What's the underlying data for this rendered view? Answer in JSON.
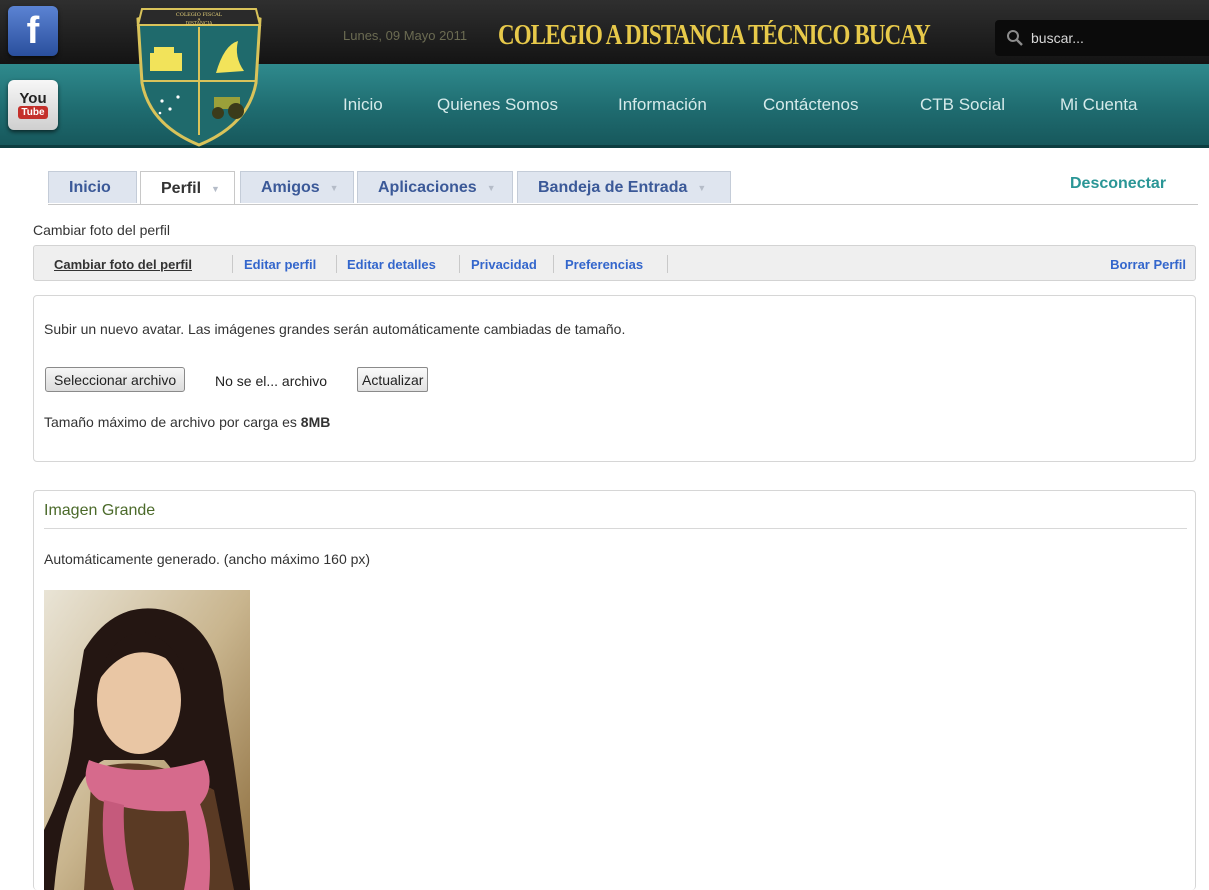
{
  "header": {
    "date": "Lunes, 09 Mayo 2011",
    "title": "COLEGIO A DISTANCIA TÉCNICO BUCAY",
    "search_placeholder": "buscar...",
    "social": {
      "facebook_letter": "f",
      "youtube_top": "You",
      "youtube_bottom": "Tube"
    },
    "logo": {
      "line1": "COLEGIO FISCAL",
      "line2": "A",
      "line3": "DISTANCIA"
    },
    "nav": [
      "Inicio",
      "Quienes Somos",
      "Información",
      "Contáctenos",
      "CTB Social",
      "Mi Cuenta"
    ]
  },
  "tabs": {
    "items": [
      {
        "label": "Inicio"
      },
      {
        "label": "Perfil"
      },
      {
        "label": "Amigos"
      },
      {
        "label": "Aplicaciones"
      },
      {
        "label": "Bandeja de Entrada"
      }
    ],
    "arrow": "▼",
    "active": "Perfil",
    "logout": "Desconectar"
  },
  "breadcrumb": "Cambiar foto del perfil",
  "subnav": {
    "items": [
      "Cambiar foto del perfil",
      "Editar perfil",
      "Editar detalles",
      "Privacidad",
      "Preferencias"
    ],
    "current": "Cambiar foto del perfil",
    "delete": "Borrar Perfil"
  },
  "upload": {
    "description": "Subir un nuevo avatar. Las imágenes grandes serán automáticamente cambiadas de tamaño.",
    "file_button": "Seleccionar archivo",
    "file_status": "No se el... archivo",
    "update_button": "Actualizar",
    "max_size_text": "Tamaño máximo de archivo por carga es ",
    "max_size_value": "8MB"
  },
  "image_panel": {
    "title": "Imagen Grande",
    "note": "Automáticamente generado. (ancho máximo 160 px)"
  },
  "colors": {
    "nav_teal": "#1f6c70",
    "title_gold": "#e7c94a",
    "link_blue": "#3366cc",
    "tab_blue": "#3b5998",
    "logout_teal": "#2a9696"
  }
}
